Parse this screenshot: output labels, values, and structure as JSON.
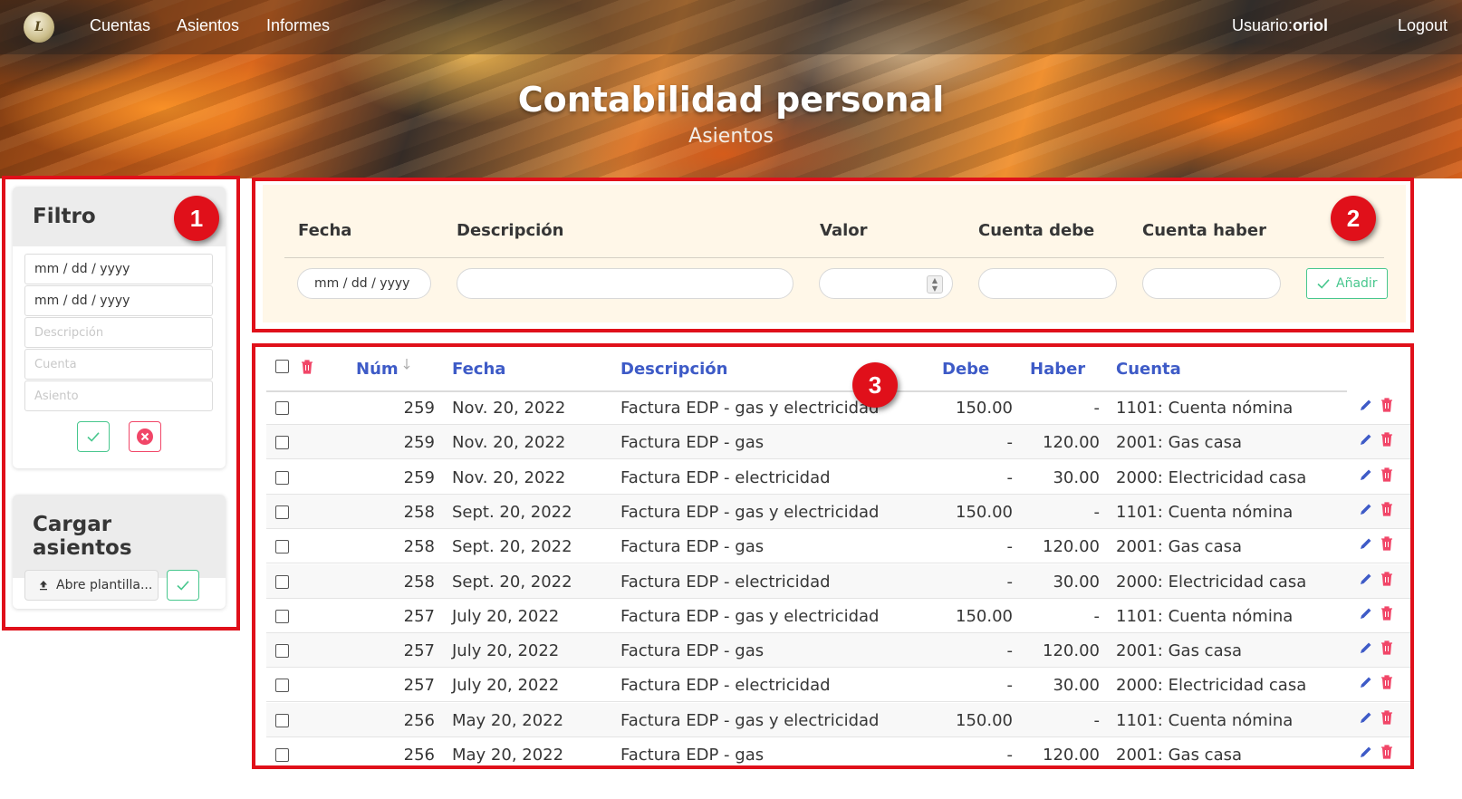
{
  "nav": {
    "links": [
      "Cuentas",
      "Asientos",
      "Informes"
    ],
    "user_prefix": "Usuario:",
    "user_name": "oriol",
    "logout": "Logout",
    "logo_text": "L"
  },
  "hero": {
    "title": "Contabilidad personal",
    "subtitle": "Asientos"
  },
  "annotations": [
    "1",
    "2",
    "3"
  ],
  "sidebar": {
    "filter": {
      "title": "Filtro",
      "date_from": "mm / dd / yyyy",
      "date_to": "mm / dd / yyyy",
      "description_placeholder": "Descripción",
      "account_placeholder": "Cuenta",
      "entry_placeholder": "Asiento"
    },
    "upload": {
      "title": "Cargar asientos",
      "file_button": "Abre plantilla..."
    }
  },
  "form": {
    "labels": [
      "Fecha",
      "Descripción",
      "Valor",
      "Cuenta debe",
      "Cuenta haber"
    ],
    "date_value": "mm / dd / yyyy",
    "add_button": "Añadir"
  },
  "table": {
    "headers": [
      "Núm",
      "Fecha",
      "Descripción",
      "Debe",
      "Haber",
      "Cuenta"
    ],
    "rows": [
      {
        "num": "259",
        "date": "Nov. 20, 2022",
        "desc": "Factura EDP - gas y electricidad",
        "debe": "150.00",
        "haber": "-",
        "cuenta": "1101: Cuenta nómina"
      },
      {
        "num": "259",
        "date": "Nov. 20, 2022",
        "desc": "Factura EDP - gas",
        "debe": "-",
        "haber": "120.00",
        "cuenta": "2001: Gas casa"
      },
      {
        "num": "259",
        "date": "Nov. 20, 2022",
        "desc": "Factura EDP - electricidad",
        "debe": "-",
        "haber": "30.00",
        "cuenta": "2000: Electricidad casa"
      },
      {
        "num": "258",
        "date": "Sept. 20, 2022",
        "desc": "Factura EDP - gas y electricidad",
        "debe": "150.00",
        "haber": "-",
        "cuenta": "1101: Cuenta nómina"
      },
      {
        "num": "258",
        "date": "Sept. 20, 2022",
        "desc": "Factura EDP - gas",
        "debe": "-",
        "haber": "120.00",
        "cuenta": "2001: Gas casa"
      },
      {
        "num": "258",
        "date": "Sept. 20, 2022",
        "desc": "Factura EDP - electricidad",
        "debe": "-",
        "haber": "30.00",
        "cuenta": "2000: Electricidad casa"
      },
      {
        "num": "257",
        "date": "July 20, 2022",
        "desc": "Factura EDP - gas y electricidad",
        "debe": "150.00",
        "haber": "-",
        "cuenta": "1101: Cuenta nómina"
      },
      {
        "num": "257",
        "date": "July 20, 2022",
        "desc": "Factura EDP - gas",
        "debe": "-",
        "haber": "120.00",
        "cuenta": "2001: Gas casa"
      },
      {
        "num": "257",
        "date": "July 20, 2022",
        "desc": "Factura EDP - electricidad",
        "debe": "-",
        "haber": "30.00",
        "cuenta": "2000: Electricidad casa"
      },
      {
        "num": "256",
        "date": "May 20, 2022",
        "desc": "Factura EDP - gas y electricidad",
        "debe": "150.00",
        "haber": "-",
        "cuenta": "1101: Cuenta nómina"
      },
      {
        "num": "256",
        "date": "May 20, 2022",
        "desc": "Factura EDP - gas",
        "debe": "-",
        "haber": "120.00",
        "cuenta": "2001: Gas casa"
      }
    ]
  },
  "colors": {
    "annotation_red": "#e0101a",
    "link_blue": "#3e5bc7",
    "success_green": "#48c78e",
    "danger_red": "#f14668",
    "form_bg": "#fff7e8"
  },
  "icons": [
    "app-logo-icon",
    "check-icon",
    "close-circle-icon",
    "upload-icon",
    "trash-icon",
    "pencil-icon",
    "sort-arrow-down-icon",
    "spinner-arrows-icon"
  ]
}
